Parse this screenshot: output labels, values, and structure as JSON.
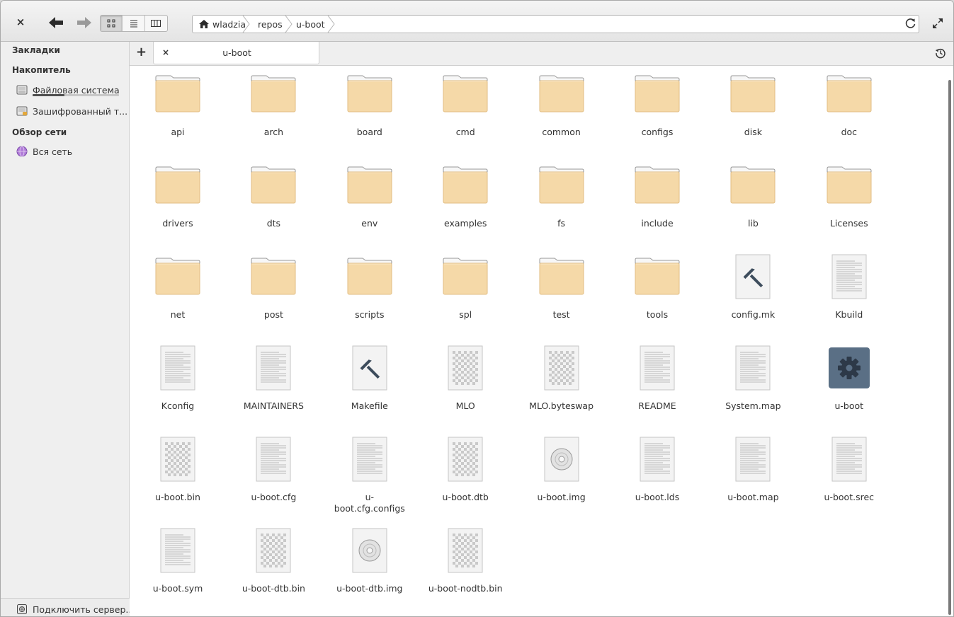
{
  "header": {
    "close_glyph": "×",
    "breadcrumbs": [
      "wladzia",
      "repos",
      "u-boot"
    ]
  },
  "sidebar": {
    "bookmarks_heading": "Закладки",
    "devices_heading": "Накопитель",
    "devices": [
      {
        "label": "Файловая система",
        "icon": "drive-harddisk-icon",
        "usage_fraction": 0.37
      },
      {
        "label": "Зашифрованный т...",
        "icon": "drive-encrypted-icon"
      }
    ],
    "network_heading": "Обзор сети",
    "network": [
      {
        "label": "Вся сеть",
        "icon": "network-globe-icon"
      }
    ],
    "footer_label": "Подключить сервер.."
  },
  "tabs": {
    "add_glyph": "+",
    "close_glyph": "×",
    "items": [
      {
        "label": "u-boot"
      }
    ]
  },
  "files": [
    {
      "name": "api",
      "type": "folder"
    },
    {
      "name": "arch",
      "type": "folder"
    },
    {
      "name": "board",
      "type": "folder"
    },
    {
      "name": "cmd",
      "type": "folder"
    },
    {
      "name": "common",
      "type": "folder"
    },
    {
      "name": "configs",
      "type": "folder"
    },
    {
      "name": "disk",
      "type": "folder"
    },
    {
      "name": "doc",
      "type": "folder"
    },
    {
      "name": "drivers",
      "type": "folder"
    },
    {
      "name": "dts",
      "type": "folder"
    },
    {
      "name": "env",
      "type": "folder"
    },
    {
      "name": "examples",
      "type": "folder"
    },
    {
      "name": "fs",
      "type": "folder"
    },
    {
      "name": "include",
      "type": "folder"
    },
    {
      "name": "lib",
      "type": "folder"
    },
    {
      "name": "Licenses",
      "type": "folder"
    },
    {
      "name": "net",
      "type": "folder"
    },
    {
      "name": "post",
      "type": "folder"
    },
    {
      "name": "scripts",
      "type": "folder"
    },
    {
      "name": "spl",
      "type": "folder"
    },
    {
      "name": "test",
      "type": "folder"
    },
    {
      "name": "tools",
      "type": "folder"
    },
    {
      "name": "config.mk",
      "type": "makefile"
    },
    {
      "name": "Kbuild",
      "type": "text"
    },
    {
      "name": "Kconfig",
      "type": "text"
    },
    {
      "name": "MAINTAINERS",
      "type": "text"
    },
    {
      "name": "Makefile",
      "type": "makefile"
    },
    {
      "name": "MLO",
      "type": "binary"
    },
    {
      "name": "MLO.byteswap",
      "type": "binary"
    },
    {
      "name": "README",
      "type": "text"
    },
    {
      "name": "System.map",
      "type": "text"
    },
    {
      "name": "u-boot",
      "type": "executable"
    },
    {
      "name": "u-boot.bin",
      "type": "binary"
    },
    {
      "name": "u-boot.cfg",
      "type": "text"
    },
    {
      "name": "u-boot.cfg.configs",
      "type": "text",
      "display": "u-\nboot.cfg.configs"
    },
    {
      "name": "u-boot.dtb",
      "type": "binary"
    },
    {
      "name": "u-boot.img",
      "type": "disc"
    },
    {
      "name": "u-boot.lds",
      "type": "text"
    },
    {
      "name": "u-boot.map",
      "type": "text"
    },
    {
      "name": "u-boot.srec",
      "type": "text"
    },
    {
      "name": "u-boot.sym",
      "type": "text"
    },
    {
      "name": "u-boot-dtb.bin",
      "type": "binary"
    },
    {
      "name": "u-boot-dtb.img",
      "type": "disc"
    },
    {
      "name": "u-boot-nodtb.bin",
      "type": "binary"
    }
  ],
  "colors": {
    "folder": "#f5d9a8",
    "folder_dark": "#e2bd83",
    "executable": "#5a6f85"
  }
}
